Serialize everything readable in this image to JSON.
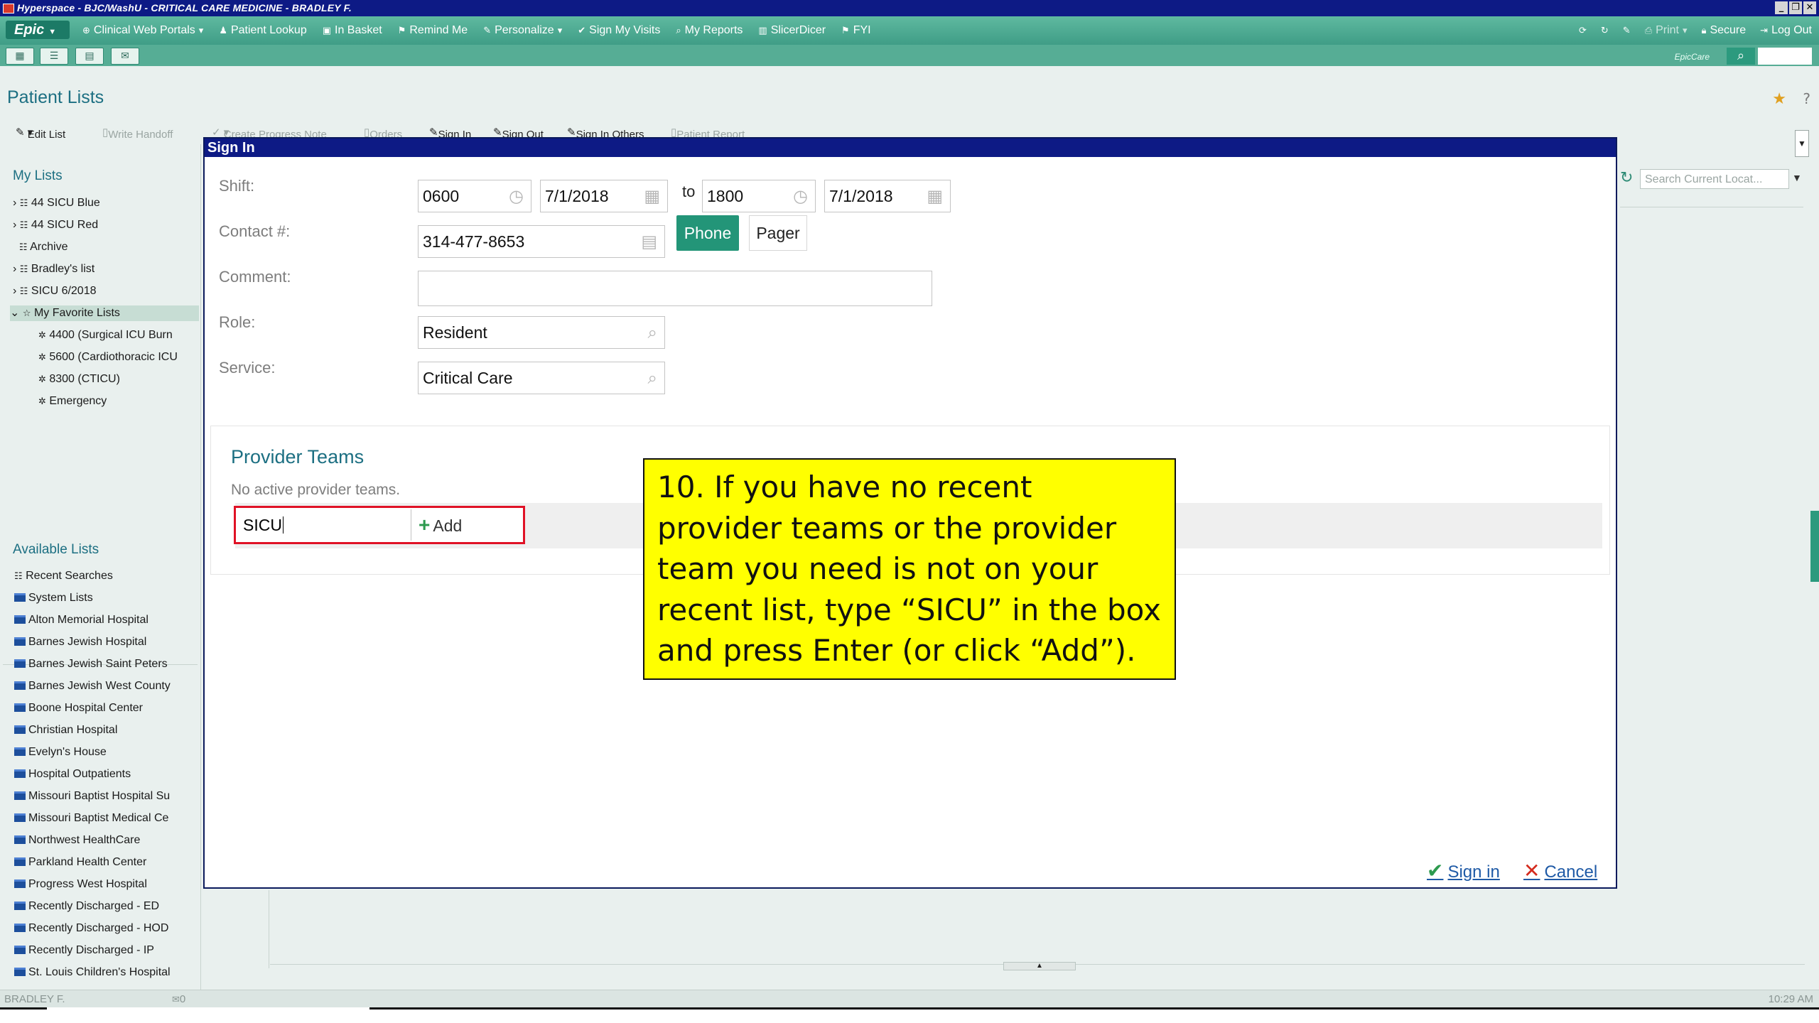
{
  "window": {
    "title": "Hyperspace - BJC/WashU - CRITICAL CARE MEDICINE - BRADLEY F.",
    "controls": [
      "_",
      "❐",
      "✕"
    ]
  },
  "toolbar": {
    "epic_label": "Epic",
    "items": [
      "Clinical Web Portals",
      "Patient Lookup",
      "In Basket",
      "Remind Me",
      "Personalize",
      "Sign My Visits",
      "My Reports",
      "SlicerDicer",
      "FYI"
    ],
    "right_items": [
      "Print",
      "Secure",
      "Log Out"
    ],
    "epiccare": "EpicCare"
  },
  "page": {
    "title": "Patient Lists",
    "actions": [
      "Edit List",
      "Write Handoff",
      "Create Progress Note",
      "Orders",
      "Sign In",
      "Sign Out",
      "Sign In Others",
      "Patient Report"
    ],
    "search_placeholder": "Search Current Locat..."
  },
  "my_lists": {
    "heading": "My Lists",
    "items": [
      "44 SICU Blue",
      "44 SICU Red",
      "Archive",
      "Bradley's list",
      "SICU 6/2018",
      "My Favorite Lists",
      "4400 (Surgical ICU Burn",
      "5600 (Cardiothoracic ICU",
      "8300 (CTICU)",
      "Emergency"
    ]
  },
  "available_lists": {
    "heading": "Available Lists",
    "items": [
      "Recent Searches",
      "System Lists",
      "Alton Memorial Hospital",
      "Barnes Jewish Hospital",
      "Barnes Jewish Saint Peters",
      "Barnes Jewish West County",
      "Boone Hospital Center",
      "Christian Hospital",
      "Evelyn's House",
      "Hospital Outpatients",
      "Missouri Baptist Hospital Su",
      "Missouri Baptist Medical Ce",
      "Northwest HealthCare",
      "Parkland Health Center",
      "Progress West Hospital",
      "Recently Discharged - ED",
      "Recently Discharged - HOD",
      "Recently Discharged - IP",
      "St. Louis Children's Hospital"
    ]
  },
  "modal": {
    "title": "Sign In",
    "shift": {
      "label": "Shift:",
      "start_time": "0600",
      "start_date": "7/1/2018",
      "to": "to",
      "end_time": "1800",
      "end_date": "7/1/2018"
    },
    "contact": {
      "label": "Contact #:",
      "value": "314-477-8653",
      "phone": "Phone",
      "pager": "Pager"
    },
    "comment": {
      "label": "Comment:",
      "value": ""
    },
    "role": {
      "label": "Role:",
      "value": "Resident"
    },
    "service": {
      "label": "Service:",
      "value": "Critical Care"
    },
    "provider_teams": {
      "title": "Provider Teams",
      "empty": "No active provider teams.",
      "input_value": "SICU",
      "add": "Add"
    },
    "sign_in": "Sign in",
    "cancel": "Cancel"
  },
  "callout": "10. If you have no recent provider teams or the provider team you need is not on your recent list, type “SICU” in the box and press Enter (or click “Add”).",
  "status": {
    "user": "BRADLEY F.",
    "mail": "0",
    "time": "10:29 AM"
  },
  "colors": {
    "title_bar": "#0d1a85",
    "toolbar": "#4fab93",
    "callout": "#ffff00",
    "highlight_border": "#e01226",
    "phone_button": "#239578"
  }
}
